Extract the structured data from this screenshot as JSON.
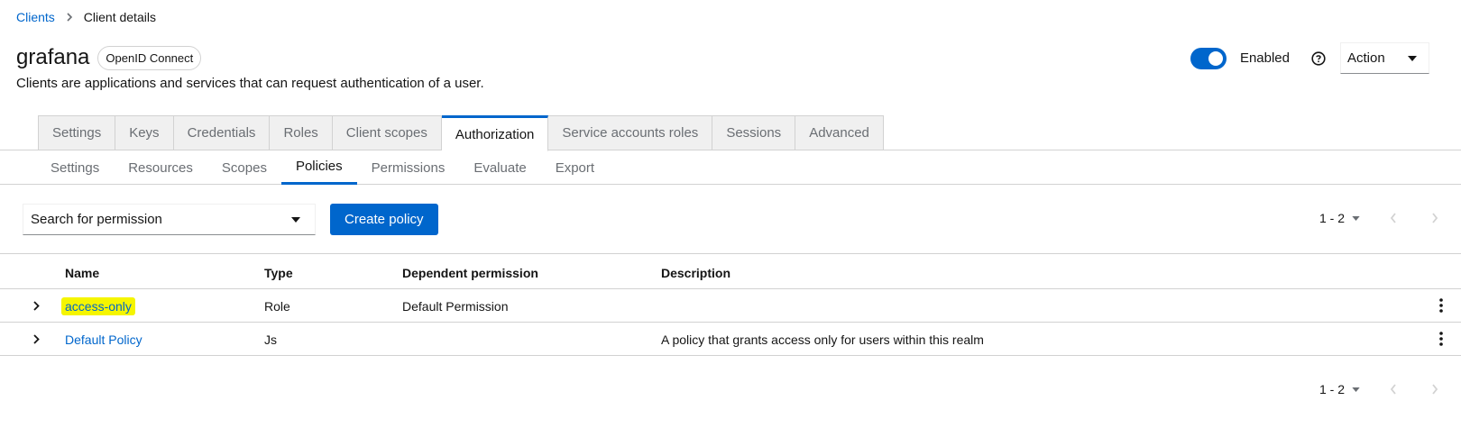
{
  "breadcrumb": {
    "parent": "Clients",
    "current": "Client details"
  },
  "header": {
    "title": "grafana",
    "badge": "OpenID Connect",
    "subtitle": "Clients are applications and services that can request authentication of a user.",
    "enabled_label": "Enabled",
    "enabled": true,
    "action_label": "Action"
  },
  "tabs": [
    {
      "label": "Settings"
    },
    {
      "label": "Keys"
    },
    {
      "label": "Credentials"
    },
    {
      "label": "Roles"
    },
    {
      "label": "Client scopes"
    },
    {
      "label": "Authorization",
      "active": true
    },
    {
      "label": "Service accounts roles"
    },
    {
      "label": "Sessions"
    },
    {
      "label": "Advanced"
    }
  ],
  "subtabs": [
    {
      "label": "Settings"
    },
    {
      "label": "Resources"
    },
    {
      "label": "Scopes"
    },
    {
      "label": "Policies",
      "active": true
    },
    {
      "label": "Permissions"
    },
    {
      "label": "Evaluate"
    },
    {
      "label": "Export"
    }
  ],
  "toolbar": {
    "search_label": "Search for permission",
    "create_label": "Create policy"
  },
  "pagination": {
    "range": "1 - 2"
  },
  "table": {
    "columns": {
      "name": "Name",
      "type": "Type",
      "dependent": "Dependent permission",
      "description": "Description"
    },
    "rows": [
      {
        "name": "access-only",
        "type": "Role",
        "dependent": "Default Permission",
        "description": ""
      },
      {
        "name": "Default Policy",
        "type": "Js",
        "dependent": "",
        "description": "A policy that grants access only for users within this realm"
      }
    ]
  },
  "colors": {
    "accent": "#0066cc",
    "highlight": "#f5f500",
    "border": "#d2d2d2"
  },
  "icons": {
    "breadcrumb_sep": "chevron-right-icon",
    "help": "question-circle-icon",
    "dropdown": "caret-down-icon",
    "expand": "chevron-right-icon",
    "kebab": "ellipsis-vertical-icon",
    "prev": "angle-left-icon",
    "next": "angle-right-icon"
  }
}
